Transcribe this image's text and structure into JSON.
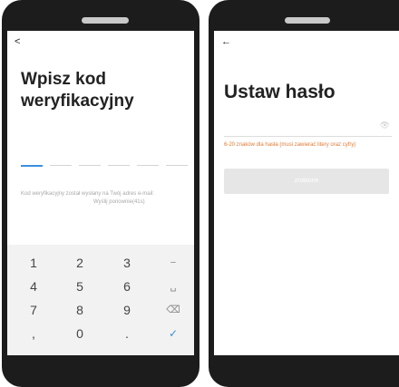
{
  "left_screen": {
    "back_icon": "<",
    "title": "Wpisz kod weryfikacyjny",
    "info_line1": "Kod weryfikacyjny został wysłany na Twój adres e-mail:",
    "info_line2": "Wyślij ponownie(41s)",
    "keypad": {
      "keys": [
        "1",
        "2",
        "3",
        "−",
        "4",
        "5",
        "6",
        "␣",
        "7",
        "8",
        "9",
        "⌫",
        ",",
        "0",
        ".",
        "✓"
      ]
    }
  },
  "right_screen": {
    "back_icon": "←",
    "title": "Ustaw hasło",
    "eye_icon": "👁",
    "hint": "6-20 znaków dla hasła (musi zawierać litery oraz cyfry)",
    "button_label": "zrobione"
  }
}
